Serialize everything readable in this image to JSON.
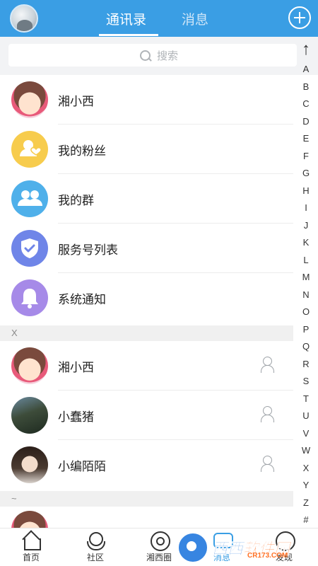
{
  "header": {
    "tabs": [
      "通讯录",
      "消息"
    ],
    "active_tab": 0,
    "accent_color": "#3a9ee4"
  },
  "search": {
    "placeholder": "搜索"
  },
  "top_items": [
    {
      "label": "湘小西",
      "icon": "cartoon-avatar"
    },
    {
      "label": "我的粉丝",
      "icon": "fans-icon"
    },
    {
      "label": "我的群",
      "icon": "group-icon"
    },
    {
      "label": "服务号列表",
      "icon": "shield-check-icon"
    },
    {
      "label": "系统通知",
      "icon": "bell-icon"
    }
  ],
  "sections": [
    {
      "letter": "X",
      "contacts": [
        {
          "name": "湘小西",
          "avatar": "cartoon-avatar"
        },
        {
          "name": "小蠢猪",
          "avatar": "street-photo-avatar"
        },
        {
          "name": "小编陌陌",
          "avatar": "person-photo-avatar"
        }
      ]
    },
    {
      "letter": "~"
    }
  ],
  "index_bar": [
    "A",
    "B",
    "C",
    "D",
    "E",
    "F",
    "G",
    "H",
    "I",
    "J",
    "K",
    "L",
    "M",
    "N",
    "O",
    "P",
    "Q",
    "R",
    "S",
    "T",
    "U",
    "V",
    "W",
    "X",
    "Y",
    "Z",
    "#"
  ],
  "bottom_nav": [
    {
      "label": "首页"
    },
    {
      "label": "社区"
    },
    {
      "label": "湘西圈"
    },
    {
      "label": "消息"
    },
    {
      "label": "发现"
    }
  ],
  "watermark": {
    "brand_a": "西西",
    "brand_b": "软件园",
    "site": "CR173.COM"
  }
}
